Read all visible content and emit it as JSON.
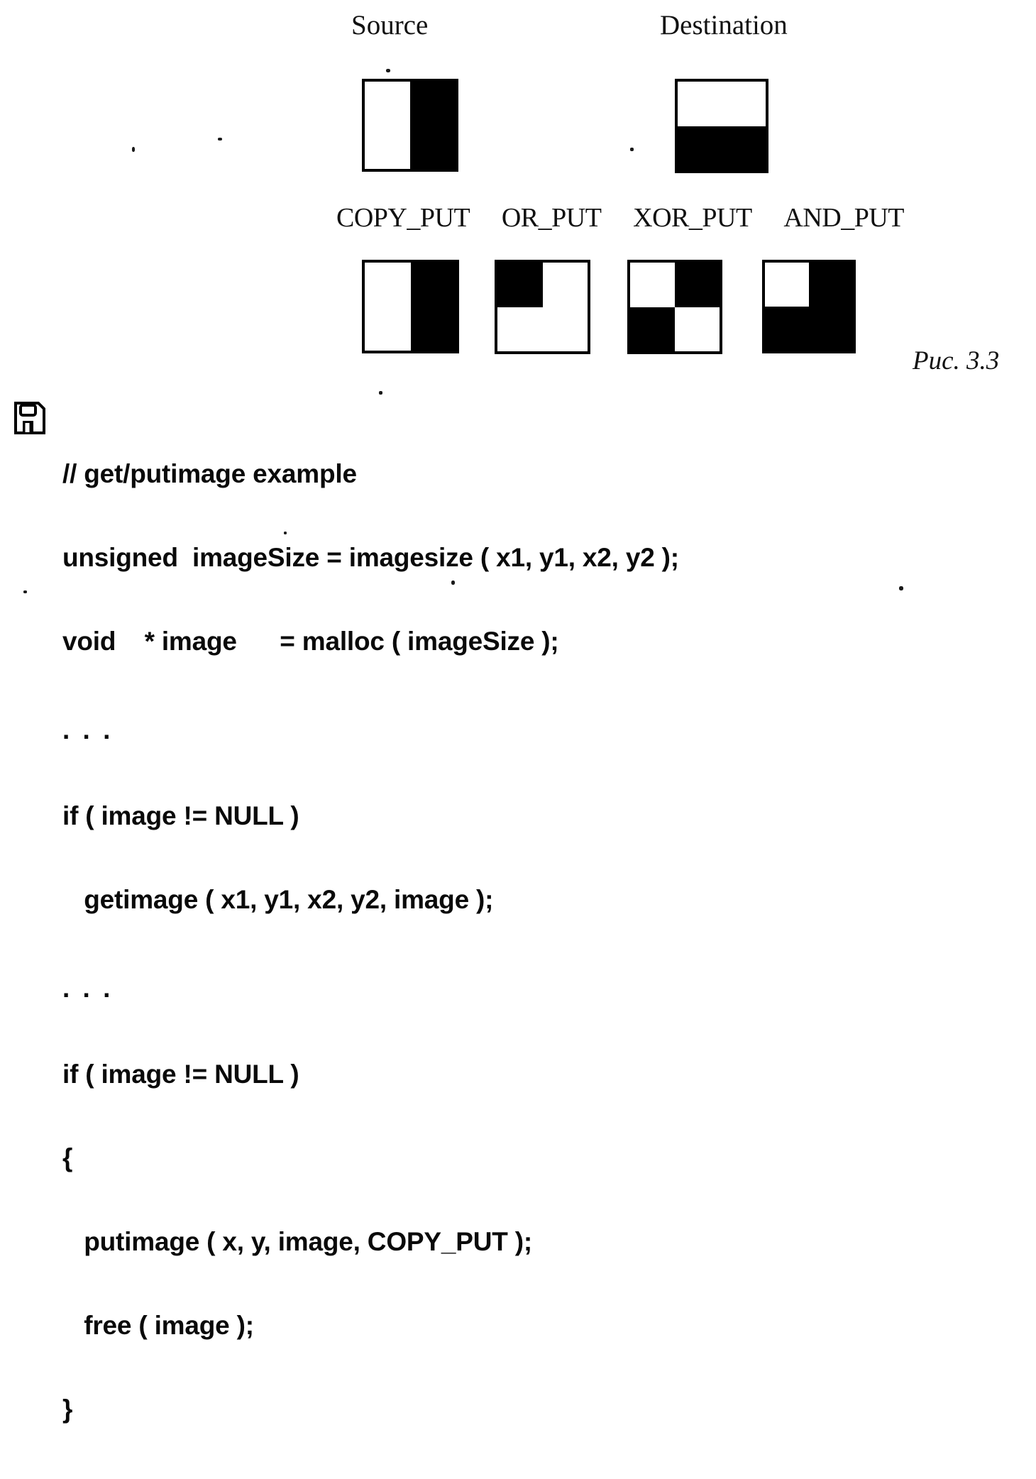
{
  "figure": {
    "caption": "Рис. 3.3",
    "headings": {
      "source": "Source",
      "destination": "Destination"
    },
    "operations": [
      {
        "label": "COPY_PUT",
        "quadrants": [
          "white",
          "black",
          "white",
          "black"
        ]
      },
      {
        "label": "OR_PUT",
        "quadrants": [
          "black",
          "white",
          "white",
          "white"
        ]
      },
      {
        "label": "XOR_PUT",
        "quadrants": [
          "white",
          "black",
          "black",
          "white"
        ]
      },
      {
        "label": "AND_PUT",
        "quadrants": [
          "white",
          "black",
          "black",
          "black"
        ]
      }
    ],
    "source_bitmap": {
      "description": "left half white, right half black",
      "quadrants": [
        "white",
        "black",
        "white",
        "black"
      ]
    },
    "destination_bitmap": {
      "description": "top half white, bottom half black",
      "quadrants": [
        "white",
        "white",
        "black",
        "black"
      ]
    },
    "colors": {
      "ink": "#000000",
      "paper": "#ffffff"
    }
  },
  "code_block": {
    "icon": "floppy-disk-icon",
    "lines": [
      {
        "text": "// get/putimage example",
        "style": "comment"
      },
      {
        "text": "unsigned  imageSize = imagesize ( x1, y1, x2, y2 );",
        "style": "code"
      },
      {
        "text": "void    * image      = malloc ( imageSize );",
        "style": "code"
      },
      {
        "text": ". . .",
        "style": "ellipsis",
        "gap": true
      },
      {
        "text": "if ( image != NULL )",
        "style": "code"
      },
      {
        "text": "   getimage ( x1, y1, x2, y2, image );",
        "style": "code"
      },
      {
        "text": ". . .",
        "style": "ellipsis",
        "gap": true
      },
      {
        "text": "if ( image != NULL )",
        "style": "code"
      },
      {
        "text": "{",
        "style": "code"
      },
      {
        "text": "   putimage ( x, y, image, COPY_PUT );",
        "style": "code"
      },
      {
        "text": "   free ( image );",
        "style": "code"
      },
      {
        "text": "}",
        "style": "code"
      }
    ]
  }
}
